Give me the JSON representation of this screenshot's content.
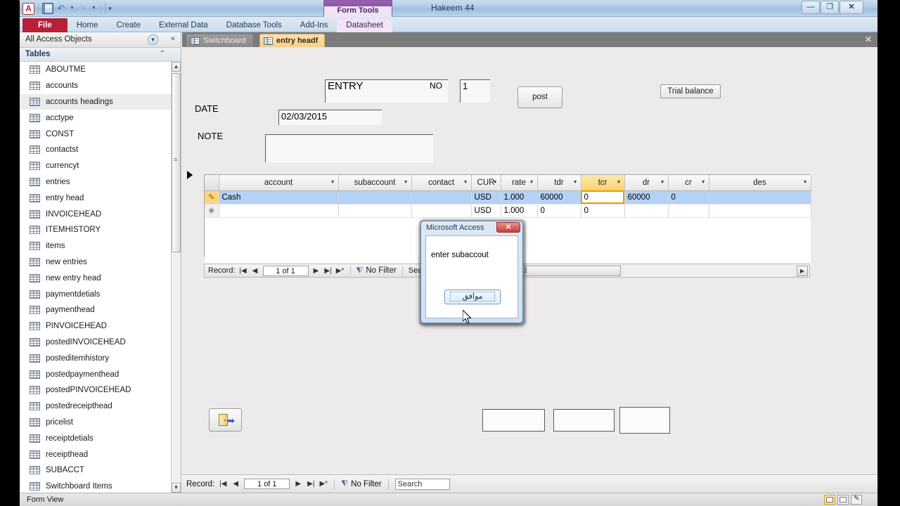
{
  "window": {
    "title": "Hakeem 44",
    "contextual_tab": "Form Tools",
    "minimize": "—",
    "restore": "❐",
    "close": "✕",
    "help": "?",
    "ribbon_collapse_caret": "▽",
    "quick_access": [
      "access-logo",
      "save-icon",
      "undo-icon",
      "redo-icon",
      "customize-qat-icon"
    ]
  },
  "ribbon": {
    "tabs": [
      {
        "label": "File"
      },
      {
        "label": "Home"
      },
      {
        "label": "Create"
      },
      {
        "label": "External Data"
      },
      {
        "label": "Database Tools"
      },
      {
        "label": "Add-Ins"
      },
      {
        "label": "Datasheet"
      }
    ]
  },
  "navpane": {
    "header": "All Access Objects",
    "group": "Tables",
    "selected": "accounts headings",
    "items": [
      "ABOUTME",
      "accounts",
      "accounts headings",
      "acctype",
      "CONST",
      "contactst",
      "currencyt",
      "entries",
      "entry head",
      "INVOICEHEAD",
      "ITEMHISTORY",
      "items",
      "new entries",
      "new entry head",
      "paymentdetials",
      "paymenthead",
      "PINVOICEHEAD",
      "postedINVOICEHEAD",
      "posteditemhistory",
      "postedpaymenthead",
      "postedPINVOICEHEAD",
      "postedreceipthead",
      "pricelist",
      "receiptdetials",
      "receipthead",
      "SUBACCT",
      "Switchboard Items"
    ]
  },
  "doc_tabs": {
    "tabs": [
      {
        "label": "Switchboard",
        "active": false
      },
      {
        "label": "entry headf",
        "active": true
      }
    ],
    "close_label": "✕"
  },
  "form": {
    "entry_label": "ENTRY",
    "entry_value": "",
    "no_label": "NO",
    "no_value": "1",
    "date_label": "DATE",
    "date_value": "02/03/2015",
    "note_label": "NOTE",
    "note_value": "",
    "post_button": "post",
    "trial_balance_button": "Trial balance",
    "exit_button_icon": "exit-door-icon",
    "total_boxes": [
      "",
      "",
      ""
    ]
  },
  "datasheet": {
    "columns": [
      {
        "label": "account",
        "selected": false
      },
      {
        "label": "subaccount",
        "selected": false
      },
      {
        "label": "contact",
        "selected": false
      },
      {
        "label": "CUR",
        "selected": false
      },
      {
        "label": "rate",
        "selected": false
      },
      {
        "label": "tdr",
        "selected": false
      },
      {
        "label": "tcr",
        "selected": true
      },
      {
        "label": "dr",
        "selected": false
      },
      {
        "label": "cr",
        "selected": false
      },
      {
        "label": "des",
        "selected": false
      }
    ],
    "rows": [
      {
        "marker": "edit-pencil-icon",
        "current": true,
        "cells": [
          "Cash",
          "",
          "",
          "USD",
          "1.000",
          "60000",
          "0",
          "60000",
          "0",
          ""
        ]
      },
      {
        "marker": "new-record-asterisk-icon",
        "current": false,
        "cells": [
          "",
          "",
          "",
          "USD",
          "1.000",
          "0",
          "0",
          "",
          "",
          ""
        ]
      }
    ],
    "selected_cell": {
      "row": 0,
      "col": 6,
      "value": "0"
    }
  },
  "sub_nav": {
    "record_label": "Record:",
    "first": "|◀",
    "prev": "◀",
    "position": "1 of 1",
    "next": "▶",
    "last": "▶|",
    "new": "▶*",
    "filter": "No Filter",
    "search_partial": "Sear"
  },
  "form_nav": {
    "record_label": "Record:",
    "first": "|◀",
    "prev": "◀",
    "position": "1 of 1",
    "next": "▶",
    "last": "▶|",
    "new": "▶*",
    "filter": "No Filter",
    "search_placeholder": "Search"
  },
  "dialog": {
    "title": "Microsoft Access",
    "close": "✕",
    "message": "enter subaccout",
    "ok_button": "موافق"
  },
  "status": {
    "view_text": "Form View",
    "views": [
      "form-view-icon",
      "layout-view-icon",
      "design-view-icon"
    ]
  },
  "colors": {
    "accent_orange": "#f8d271",
    "row_selected": "#b4d2f5",
    "file_tab": "#b6203a",
    "contextual": "#8c56a8"
  }
}
